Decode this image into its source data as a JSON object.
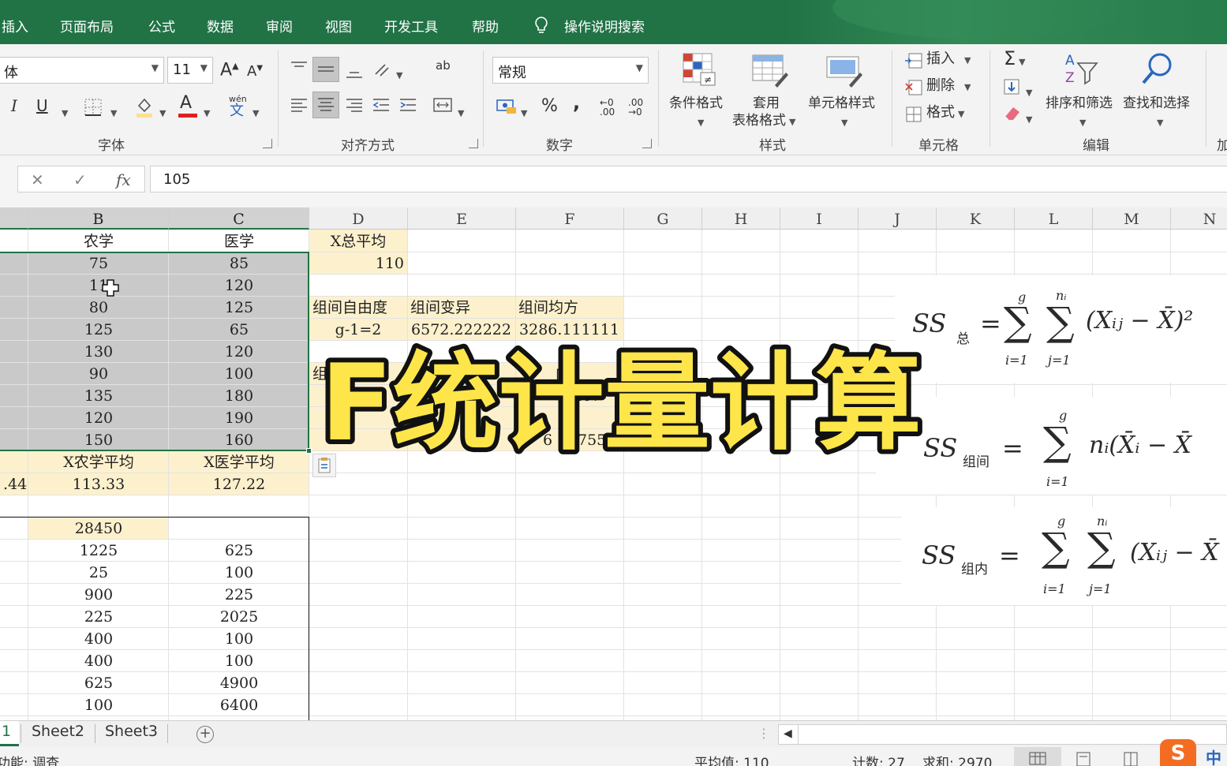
{
  "menu": {
    "tabs": [
      "插入",
      "页面布局",
      "公式",
      "数据",
      "审阅",
      "视图",
      "开发工具",
      "帮助"
    ],
    "search": "操作说明搜索"
  },
  "ribbon": {
    "font_name": "体",
    "font_size": "11",
    "grow_label": "A",
    "shrink_label": "A",
    "italic": "I",
    "underline": "U",
    "phonetic": "wén",
    "phonetic_char": "文",
    "font_color_letter": "A",
    "group_font": "字体",
    "group_align": "对齐方式",
    "wrap_label": "ab",
    "number_format": "常规",
    "percent": "%",
    "comma": ",",
    "inc_decimal": "←0 .00",
    "dec_decimal": ".00 →0",
    "group_number": "数字",
    "cond_format": "条件格式",
    "table_format_line1": "套用",
    "table_format_line2": "表格格式",
    "cell_style": "单元格样式",
    "group_styles": "样式",
    "insert": "插入",
    "delete": "删除",
    "format": "格式",
    "group_cells": "单元格",
    "sum_symbol": "Σ",
    "sort_filter": "排序和筛选",
    "find_select": "查找和选择",
    "group_edit": "编辑",
    "truncated_group": "加"
  },
  "formula_bar": {
    "cancel": "✕",
    "confirm": "✓",
    "fx": "fx",
    "value": "105"
  },
  "columns": [
    "B",
    "C",
    "D",
    "E",
    "F",
    "G",
    "H",
    "I",
    "J",
    "K",
    "L",
    "M",
    "N"
  ],
  "cells": {
    "b1": "农学",
    "c1": "医学",
    "d1": "X总平均",
    "d2": "110",
    "b2": "75",
    "c2": "85",
    "b3": "11",
    "c3": "120",
    "b4": "80",
    "c4": "125",
    "b5": "125",
    "c5": "65",
    "b6": "130",
    "c6": "120",
    "b7": "90",
    "c7": "100",
    "b8": "135",
    "c8": "180",
    "b9": "120",
    "c9": "190",
    "b10": "150",
    "c10": "160",
    "d4": "组间自由度",
    "e4": "组间变异",
    "f4": "组间均方",
    "d5": "g-1=2",
    "e5": "6572.222222",
    "f5": "3286.111111",
    "frag_d7": "组",
    "frag_f7": "内",
    "frag_f8": "407",
    "frag_f9_a": "6",
    "frag_f9_b": "755",
    "a11_label": "",
    "b11": "X农学平均",
    "c11": "X医学平均",
    "a12": ".44",
    "b12": "113.33",
    "c12": "127.22",
    "b14": "28450",
    "b15": "1225",
    "c15": "625",
    "b16": "25",
    "c16": "100",
    "b17": "900",
    "c17": "225",
    "b18": "225",
    "c18": "2025",
    "b19": "400",
    "c19": "100",
    "b20": "400",
    "c20": "100",
    "b21": "625",
    "c21": "4900",
    "b22": "100",
    "c22": "6400"
  },
  "formulas": {
    "ss_total_lhs": "SS",
    "ss_total_sub": "总",
    "ss_between_lhs": "SS",
    "ss_between_sub": "组间",
    "ss_within_lhs": "SS",
    "ss_within_sub": "组内",
    "sum_upper_g": "g",
    "sum_upper_ni": "nᵢ",
    "sum_lower_i": "i=1",
    "sum_lower_j": "j=1",
    "term_total": "(Xᵢⱼ − X̄)²",
    "term_between": "nᵢ(X̄ᵢ − X̄",
    "term_within": "(Xᵢⱼ − X̄"
  },
  "overlay_title": "F统计量计算",
  "sheets": {
    "active_fragment": "1",
    "tabs": [
      "Sheet2",
      "Sheet3"
    ],
    "add": "+"
  },
  "status": {
    "mode": "功能: 调查",
    "average": "平均值: 110",
    "count": "计数: 27",
    "sum": "求和: 2970",
    "ime": "中"
  },
  "colors": {
    "excel_green": "#217346",
    "selection_gray": "#c9c9c9",
    "highlight_yellow": "#fdf1cd",
    "title_fill": "#fde54a",
    "title_stroke": "#111111"
  }
}
